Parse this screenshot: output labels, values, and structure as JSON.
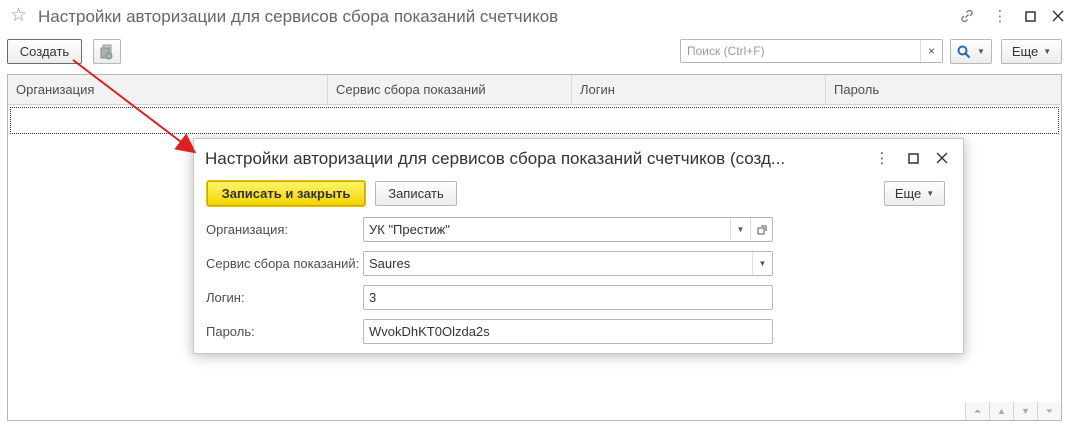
{
  "window": {
    "title": "Настройки авторизации для сервисов сбора показаний счетчиков",
    "star_icon": "☆",
    "link_icon": "link-icon",
    "more_icon": "⋮",
    "maximize_icon": "□",
    "close_icon": "✕"
  },
  "toolbar": {
    "create_label": "Создать",
    "search_placeholder": "Поиск (Ctrl+F)",
    "search_clear": "×",
    "more_label": "Еще"
  },
  "table": {
    "columns": [
      "Организация",
      "Сервис сбора показаний",
      "Логин",
      "Пароль"
    ]
  },
  "dialog": {
    "title": "Настройки авторизации для сервисов сбора показаний счетчиков (созд...",
    "more_icon": "⋮",
    "maximize_icon": "□",
    "close_icon": "✕",
    "save_close_label": "Записать и закрыть",
    "save_label": "Записать",
    "more_label": "Еще",
    "fields": {
      "organization": {
        "label": "Организация:",
        "value": "УК \"Престиж\""
      },
      "service": {
        "label": "Сервис сбора показаний:",
        "value": "Saures"
      },
      "login": {
        "label": "Логин:",
        "value": "3"
      },
      "password": {
        "label": "Пароль:",
        "value": "WvokDhKT0Olzda2s"
      }
    }
  },
  "colors": {
    "primary_button": "#f2d400",
    "arrow": "#e02020"
  }
}
